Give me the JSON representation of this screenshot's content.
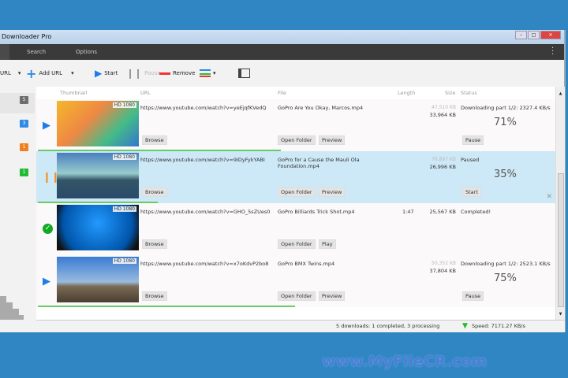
{
  "window": {
    "title": "Downloader Pro"
  },
  "menu": [
    "Search",
    "Options"
  ],
  "toolbar": {
    "paste_url": "URL",
    "add_url": "Add URL",
    "start": "Start",
    "pause": "Pause",
    "remove": "Remove"
  },
  "sidebar": {
    "badges": [
      {
        "count": "5",
        "color": "#6d6d6d"
      },
      {
        "count": "3",
        "color": "#2f8ae6"
      },
      {
        "count": "1",
        "color": "#f08020"
      },
      {
        "count": "1",
        "color": "#22bb33"
      }
    ]
  },
  "columns": {
    "thumbnail": "Thumbnail",
    "url": "URL",
    "file": "File",
    "length": "Length",
    "size": "Size",
    "status": "Status"
  },
  "downloads": [
    {
      "state": "downloading",
      "quality": "HD 1080",
      "url": "https://www.youtube.com/watch?v=yeEjqfKVedQ",
      "file": "GoPro  Are You Okay, Marcos.mp4",
      "length": "",
      "total": "47,510 KB",
      "current": "33,964 KB",
      "status": "Downloading part 1/2: 2327.4 KB/s",
      "percent": "71%",
      "progress": 71,
      "browse": "Browse",
      "folder": "Open Folder",
      "action2": "Preview",
      "action": "Pause"
    },
    {
      "state": "paused",
      "quality": "HD 1080",
      "url": "https://www.youtube.com/watch?v=9IDyFykYABI",
      "file": "GoPro for a Cause  the Mauli Ola Foundation.mp4",
      "length": "",
      "total": "76,897 KB",
      "current": "26,996 KB",
      "status": "Paused",
      "percent": "35%",
      "progress": 35,
      "browse": "Browse",
      "folder": "Open Folder",
      "action2": "Preview",
      "action": "Start"
    },
    {
      "state": "completed",
      "quality": "HD 1080",
      "url": "https://www.youtube.com/watch?v=GHO_5sZUes0",
      "file": "GoPro  Billiards Trick Shot.mp4",
      "length": "1:47",
      "total": "",
      "current": "25,567 KB",
      "status": "Completed!",
      "percent": "",
      "progress": 0,
      "browse": "Browse",
      "folder": "Open Folder",
      "action2": "Play",
      "action": ""
    },
    {
      "state": "downloading",
      "quality": "HD 1080",
      "url": "https://www.youtube.com/watch?v=x7oKdvP2bo8",
      "file": "GoPro  BMX Twins.mp4",
      "length": "",
      "total": "50,352 KB",
      "current": "37,804 KB",
      "status": "Downloading part 1/2: 2523.1 KB/s",
      "percent": "75%",
      "progress": 75,
      "browse": "Browse",
      "folder": "Open Folder",
      "action2": "Preview",
      "action": "Pause"
    }
  ],
  "statusbar": {
    "summary": "5 downloads: 1 completed, 3 processing",
    "speed": "Speed: 7171.27 KB/s"
  },
  "watermark": "www.MyFileCR.com"
}
